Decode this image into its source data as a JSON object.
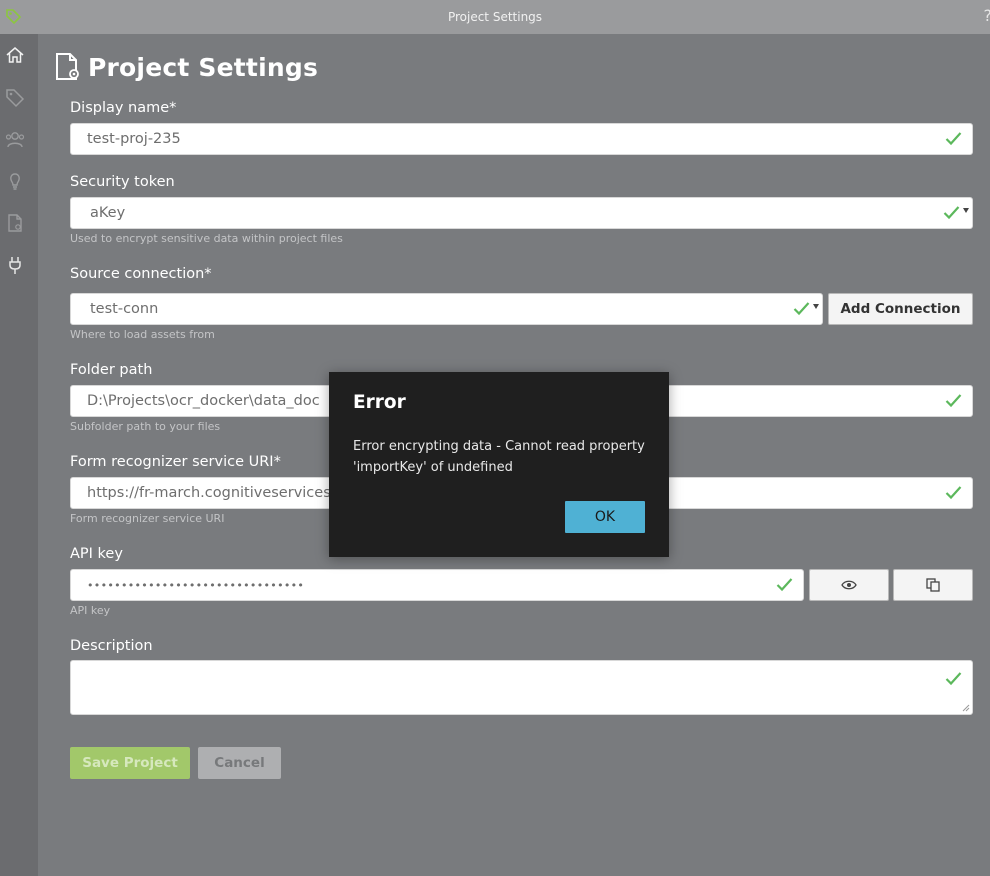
{
  "window": {
    "title": "Project Settings",
    "help": "?"
  },
  "sidebar": {
    "items": [
      {
        "icon": "home-icon"
      },
      {
        "icon": "tag-icon"
      },
      {
        "icon": "people-icon"
      },
      {
        "icon": "lightbulb-icon"
      },
      {
        "icon": "document-icon"
      },
      {
        "icon": "plug-icon"
      }
    ]
  },
  "page": {
    "title": "Project Settings"
  },
  "form": {
    "display_name": {
      "label": "Display name*",
      "value": "test-proj-235"
    },
    "security_token": {
      "label": "Security token",
      "value": "aKey",
      "hint": "Used to encrypt sensitive data within project files"
    },
    "source_connection": {
      "label": "Source connection*",
      "value": "test-conn",
      "hint": "Where to load assets from",
      "add_button": "Add Connection"
    },
    "folder_path": {
      "label": "Folder path",
      "value": "D:\\Projects\\ocr_docker\\data_doc",
      "hint": "Subfolder path to your files"
    },
    "service_uri": {
      "label": "Form recognizer service URI*",
      "value": "https://fr-march.cognitiveservices.azu",
      "hint": "Form recognizer service URI"
    },
    "api_key": {
      "label": "API key",
      "value": "••••••••••••••••••••••••••••••••",
      "hint": "API key"
    },
    "description": {
      "label": "Description",
      "value": ""
    },
    "save_label": "Save Project",
    "cancel_label": "Cancel"
  },
  "dialog": {
    "title": "Error",
    "message": "Error encrypting data - Cannot read property 'importKey' of undefined",
    "ok_label": "OK"
  },
  "colors": {
    "valid_check": "#5cb85c",
    "ok_button": "#4fb1d4",
    "save_button": "#a2c86a"
  }
}
